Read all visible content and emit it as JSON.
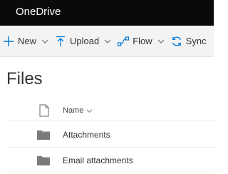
{
  "app": {
    "title": "OneDrive"
  },
  "commandbar": {
    "items": [
      {
        "label": "New",
        "icon": "plus-icon",
        "has_dropdown": true
      },
      {
        "label": "Upload",
        "icon": "upload-icon",
        "has_dropdown": true
      },
      {
        "label": "Flow",
        "icon": "flow-icon",
        "has_dropdown": true
      },
      {
        "label": "Sync",
        "icon": "sync-icon",
        "has_dropdown": false
      }
    ]
  },
  "page": {
    "title": "Files"
  },
  "list": {
    "columns": {
      "name": "Name",
      "file_type_icon": "document-icon"
    },
    "rows": [
      {
        "name": "Attachments",
        "icon": "folder-icon"
      },
      {
        "name": "Email attachments",
        "icon": "folder-icon"
      }
    ]
  },
  "colors": {
    "topbar": "#0a0a0a",
    "accent": "#0078d4",
    "commandbar": "#f3f3f3",
    "folder": "#7a7a7a"
  }
}
